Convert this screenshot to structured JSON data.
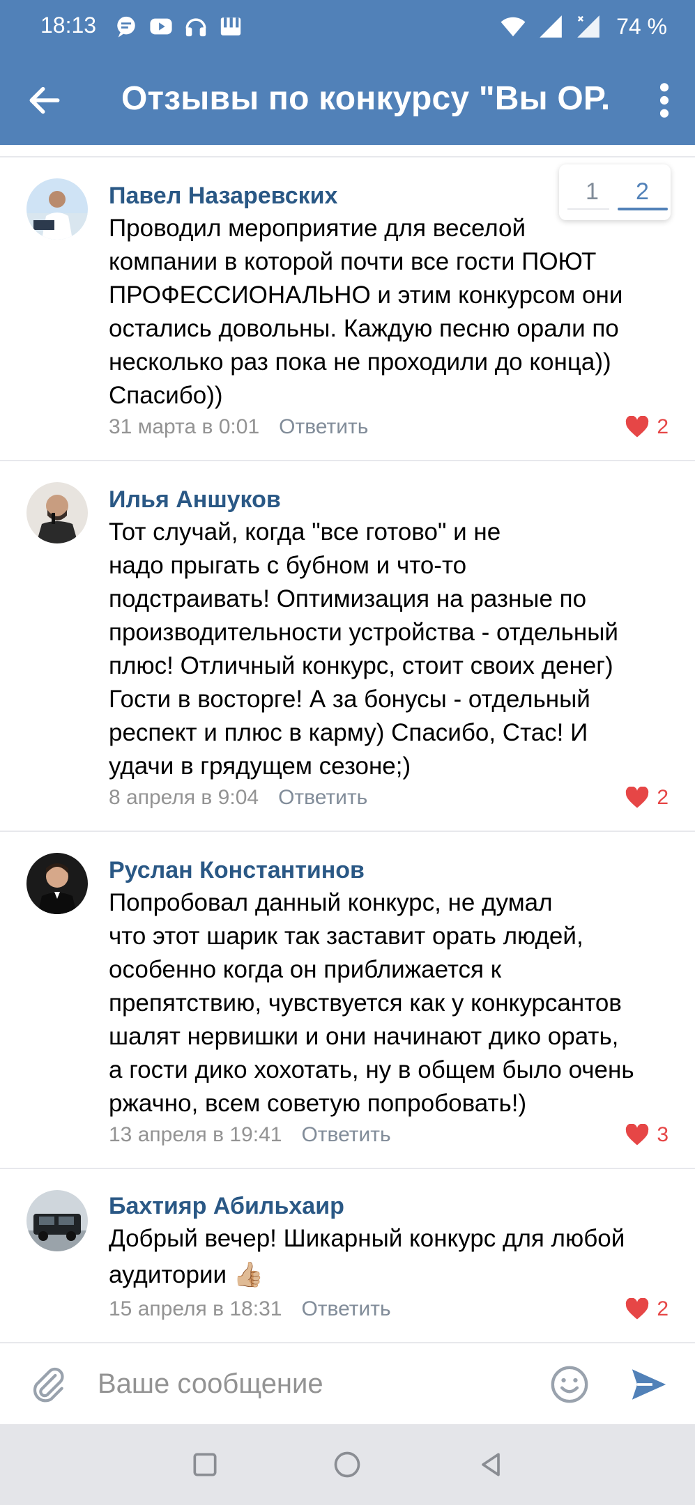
{
  "status_bar": {
    "time": "18:13",
    "battery": "74 %"
  },
  "app_bar": {
    "title": "Отзывы по конкурсу \"Вы ОР..."
  },
  "pagination": {
    "pages": [
      "1",
      "2"
    ],
    "current": "2"
  },
  "comments": [
    {
      "author": "Павел Назаревских",
      "lines": [
        "Проводил мероприятие  для веселой",
        "компании в которой почти все гости ПОЮТ",
        "ПРОФЕССИОНАЛЬНО и этим конкурсом они",
        "остались довольны. Каждую песню орали по",
        "несколько раз пока не проходили до конца))",
        "Спасибо))"
      ],
      "date": "31 марта в 0:01",
      "reply": "Ответить",
      "likes": "2"
    },
    {
      "author": "Илья Аншуков",
      "lines": [
        "Тот случай, когда \"все готово\" и не",
        "надо прыгать с бубном и что-то",
        "подстраивать! Оптимизация на разные по",
        "производительности устройства - отдельный",
        "плюс!  Отличный конкурс, стоит своих денег)",
        "Гости в восторге! А за бонусы - отдельный",
        "респект и плюс в карму) Спасибо, Стас! И",
        "удачи в грядущем сезоне;)"
      ],
      "date": "8 апреля в 9:04",
      "reply": "Ответить",
      "likes": "2"
    },
    {
      "author": "Руслан Константинов",
      "lines": [
        "Попробовал данный конкурс, не думал",
        "что этот шарик так заставит орать людей,",
        "особенно когда он приближается к",
        "препятствию, чувствуется как у конкурсантов",
        "шалят нервишки и они начинают дико орать,",
        "а гости дико хохотать, ну в общем было очень",
        "ржачно, всем советую попробовать!)"
      ],
      "date": "13 апреля в 19:41",
      "reply": "Ответить",
      "likes": "3"
    },
    {
      "author": "Бахтияр Абильхаир",
      "lines": [
        "Добрый вечер! Шикарный конкурс для любой",
        "аудитории 👍🏼"
      ],
      "date": "15 апреля в 18:31",
      "reply": "Ответить",
      "likes": "2"
    }
  ],
  "composer": {
    "placeholder": "Ваше сообщение"
  },
  "colors": {
    "header": "#5181b8",
    "author": "#2a5885",
    "like": "#e64646",
    "meta": "#939393"
  }
}
